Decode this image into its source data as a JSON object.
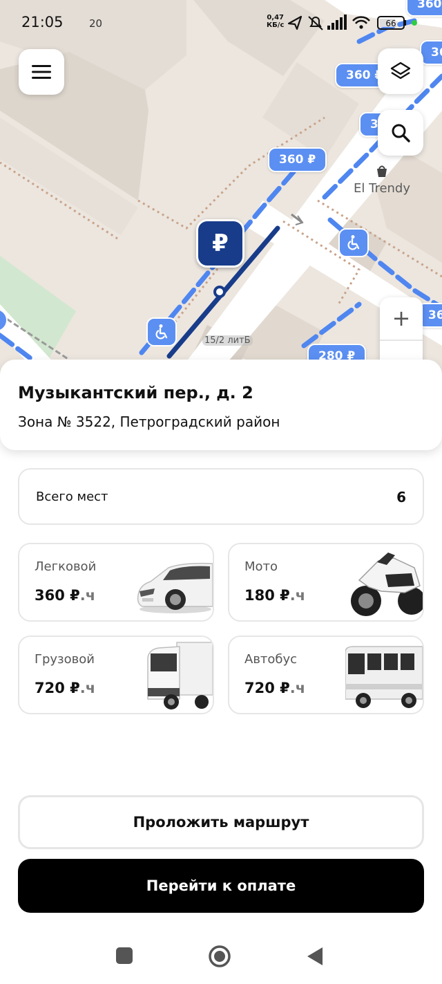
{
  "status_bar": {
    "time": "21:05",
    "extra": "20",
    "net_speed_value": "0,47",
    "net_speed_unit": "КБ/с",
    "battery": "66"
  },
  "map": {
    "price_labels": [
      "360 ₽",
      "360 ₽",
      "360 ₽",
      "360",
      "36",
      "36",
      "360",
      "280 ₽"
    ],
    "poi_name": "El Trendy",
    "house_label": "15/2 литБ",
    "parking_symbol": "₽",
    "zoom_in": "+"
  },
  "address": {
    "title": "Музыкантский пер., д. 2",
    "subtitle": "Зона № 3522, Петроградский район"
  },
  "total": {
    "label": "Всего мест",
    "value": "6"
  },
  "vehicles": [
    {
      "name": "Легковой",
      "price": "360 ₽",
      "unit": ".ч",
      "icon": "car-image"
    },
    {
      "name": "Мото",
      "price": "180 ₽",
      "unit": ".ч",
      "icon": "motorcycle-image"
    },
    {
      "name": "Грузовой",
      "price": "720 ₽",
      "unit": ".ч",
      "icon": "truck-image"
    },
    {
      "name": "Автобус",
      "price": "720 ₽",
      "unit": ".ч",
      "icon": "bus-image"
    }
  ],
  "actions": {
    "route_label": "Проложить маршрут",
    "pay_label": "Перейти к оплате"
  },
  "colors": {
    "accent_blue": "#5b8ff2",
    "selected_marker": "#183c8a",
    "pay_button": "#000000"
  }
}
